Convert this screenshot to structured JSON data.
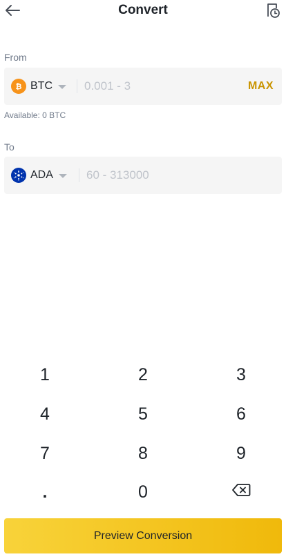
{
  "header": {
    "title": "Convert",
    "back_icon": "arrow-left-icon",
    "history_icon": "order-history-icon"
  },
  "from": {
    "label": "From",
    "coin": "BTC",
    "coin_color": "#f7931a",
    "amount_placeholder": "0.001 - 3",
    "max_label": "MAX",
    "available_text": "Available: 0 BTC"
  },
  "to": {
    "label": "To",
    "coin": "ADA",
    "coin_color": "#0033ad",
    "amount_placeholder": "60 - 313000"
  },
  "keypad": {
    "keys": [
      "1",
      "2",
      "3",
      "4",
      "5",
      "6",
      "7",
      "8",
      "9",
      ".",
      "0"
    ],
    "backspace_icon": "backspace-icon"
  },
  "actions": {
    "preview_label": "Preview Conversion"
  },
  "colors": {
    "accent": "#f0b90b",
    "max_text": "#c99400",
    "field_bg": "#f5f5f5"
  }
}
